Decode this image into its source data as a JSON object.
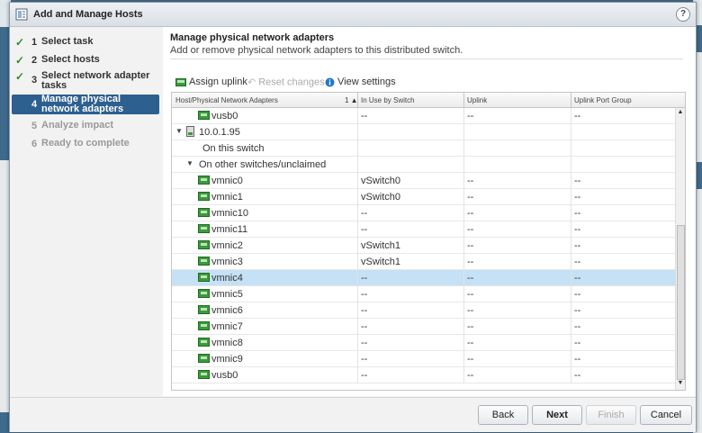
{
  "dialog": {
    "title": "Add and Manage Hosts",
    "help_label": "?"
  },
  "steps": [
    {
      "num": "1",
      "label": "Select task",
      "state": "done"
    },
    {
      "num": "2",
      "label": "Select hosts",
      "state": "done"
    },
    {
      "num": "3",
      "label": "Select network adapter tasks",
      "state": "done"
    },
    {
      "num": "4",
      "label": "Manage physical network adapters",
      "state": "active"
    },
    {
      "num": "5",
      "label": "Analyze impact",
      "state": "pending"
    },
    {
      "num": "6",
      "label": "Ready to complete",
      "state": "pending"
    }
  ],
  "content": {
    "title": "Manage physical network adapters",
    "subtitle": "Add or remove physical network adapters to this distributed switch."
  },
  "toolbar": {
    "assign_uplink": "Assign uplink",
    "reset_changes": "Reset changes",
    "view_settings": "View settings"
  },
  "grid": {
    "columns": [
      "Host/Physical Network Adapters",
      "In Use by Switch",
      "Uplink",
      "Uplink Port Group"
    ],
    "sort_indicator": "1 ▲",
    "rows": [
      {
        "name": "vusb0",
        "switch": "--",
        "uplink": "--",
        "group": "--",
        "kind": "nic",
        "indent": 1
      },
      {
        "name": "10.0.1.95",
        "switch": "",
        "uplink": "",
        "group": "",
        "kind": "host",
        "indent": 0
      },
      {
        "name": "On this switch",
        "switch": "",
        "uplink": "",
        "group": "",
        "kind": "label",
        "indent": 1
      },
      {
        "name": "On other switches/unclaimed",
        "switch": "",
        "uplink": "",
        "group": "",
        "kind": "group",
        "indent": 1
      },
      {
        "name": "vmnic0",
        "switch": "vSwitch0",
        "uplink": "--",
        "group": "--",
        "kind": "nic",
        "indent": 1
      },
      {
        "name": "vmnic1",
        "switch": "vSwitch0",
        "uplink": "--",
        "group": "--",
        "kind": "nic",
        "indent": 1
      },
      {
        "name": "vmnic10",
        "switch": "--",
        "uplink": "--",
        "group": "--",
        "kind": "nic",
        "indent": 1
      },
      {
        "name": "vmnic11",
        "switch": "--",
        "uplink": "--",
        "group": "--",
        "kind": "nic",
        "indent": 1
      },
      {
        "name": "vmnic2",
        "switch": "vSwitch1",
        "uplink": "--",
        "group": "--",
        "kind": "nic",
        "indent": 1
      },
      {
        "name": "vmnic3",
        "switch": "vSwitch1",
        "uplink": "--",
        "group": "--",
        "kind": "nic",
        "indent": 1
      },
      {
        "name": "vmnic4",
        "switch": "--",
        "uplink": "--",
        "group": "--",
        "kind": "nic",
        "indent": 1,
        "selected": true
      },
      {
        "name": "vmnic5",
        "switch": "--",
        "uplink": "--",
        "group": "--",
        "kind": "nic",
        "indent": 1
      },
      {
        "name": "vmnic6",
        "switch": "--",
        "uplink": "--",
        "group": "--",
        "kind": "nic",
        "indent": 1
      },
      {
        "name": "vmnic7",
        "switch": "--",
        "uplink": "--",
        "group": "--",
        "kind": "nic",
        "indent": 1
      },
      {
        "name": "vmnic8",
        "switch": "--",
        "uplink": "--",
        "group": "--",
        "kind": "nic",
        "indent": 1
      },
      {
        "name": "vmnic9",
        "switch": "--",
        "uplink": "--",
        "group": "--",
        "kind": "nic",
        "indent": 1
      },
      {
        "name": "vusb0",
        "switch": "--",
        "uplink": "--",
        "group": "--",
        "kind": "nic",
        "indent": 1
      }
    ]
  },
  "footer": {
    "back": "Back",
    "next": "Next",
    "finish": "Finish",
    "cancel": "Cancel"
  }
}
